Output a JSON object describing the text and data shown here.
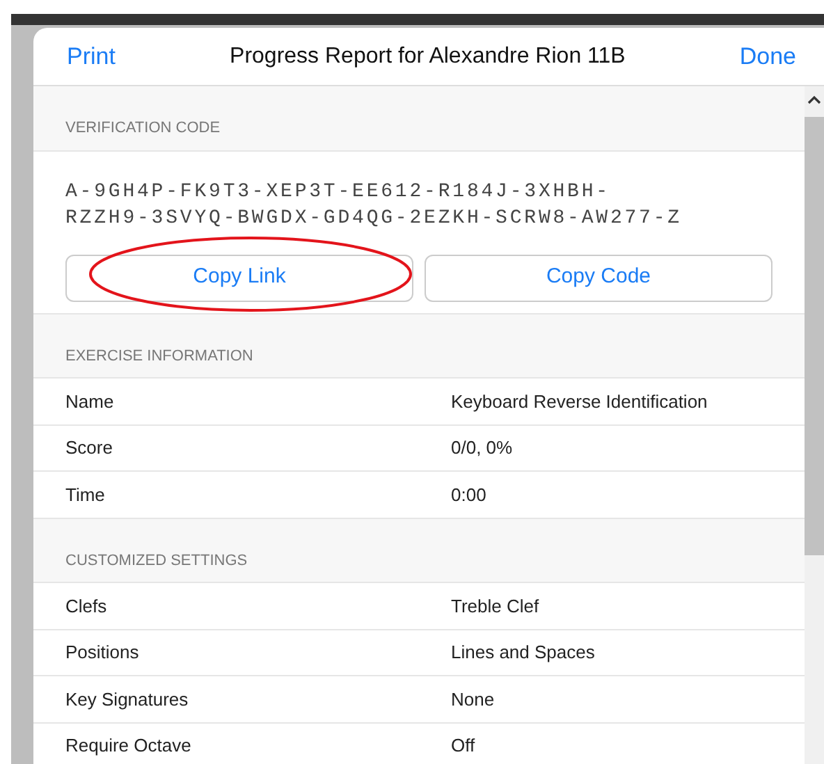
{
  "header": {
    "left_action": "Print",
    "title": "Progress Report for Alexandre Rion 11B",
    "right_action": "Done"
  },
  "verification": {
    "heading": "VERIFICATION CODE",
    "code": "A-9GH4P-FK9T3-XEP3T-EE612-R184J-3XHBH-RZZH9-3SVYQ-BWGDX-GD4QG-2EZKH-SCRW8-AW277-Z",
    "buttons": [
      {
        "label": "Copy Link",
        "circled": true
      },
      {
        "label": "Copy Code",
        "circled": false
      }
    ]
  },
  "sections": [
    {
      "heading": "EXERCISE INFORMATION",
      "rows": [
        {
          "label": "Name",
          "value": "Keyboard Reverse Identification"
        },
        {
          "label": "Score",
          "value": "0/0, 0%"
        },
        {
          "label": "Time",
          "value": "0:00"
        }
      ]
    },
    {
      "heading": "CUSTOMIZED SETTINGS",
      "rows": [
        {
          "label": "Clefs",
          "value": "Treble Clef"
        },
        {
          "label": "Positions",
          "value": "Lines and Spaces"
        },
        {
          "label": "Key Signatures",
          "value": "None"
        },
        {
          "label": "Require Octave",
          "value": "Off"
        }
      ]
    }
  ]
}
